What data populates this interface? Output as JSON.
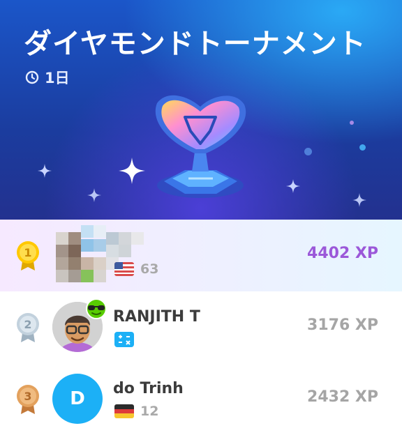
{
  "header": {
    "title": "ダイヤモンドトーナメント",
    "timer_icon": "clock-icon",
    "timer_text": "1日"
  },
  "leaderboard": [
    {
      "rank": "1",
      "name": "",
      "xp": "4402 XP",
      "flag": "us-flag-icon",
      "count": "63",
      "medal": "gold"
    },
    {
      "rank": "2",
      "name": "RANJITH T",
      "xp": "3176 XP",
      "badge": "calculator-icon",
      "medal": "silver"
    },
    {
      "rank": "3",
      "name": "do Trinh",
      "avatar_letter": "D",
      "xp": "2432 XP",
      "flag": "de-flag-icon",
      "count": "12",
      "medal": "bronze"
    }
  ],
  "colors": {
    "gold": "#ffc800",
    "silver": "#c2d1dd",
    "bronze": "#e3a15d",
    "avatar_blue": "#1cb0f6",
    "highlight_xp": "#9b58d9"
  }
}
